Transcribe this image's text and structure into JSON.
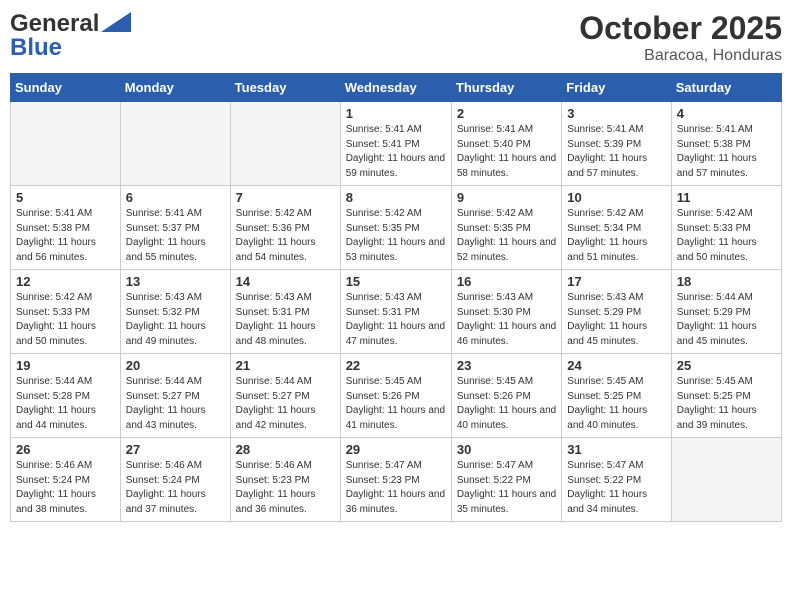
{
  "header": {
    "logo_general": "General",
    "logo_blue": "Blue",
    "month": "October 2025",
    "location": "Baracoa, Honduras"
  },
  "days_of_week": [
    "Sunday",
    "Monday",
    "Tuesday",
    "Wednesday",
    "Thursday",
    "Friday",
    "Saturday"
  ],
  "weeks": [
    [
      {
        "day": "",
        "sunrise": "",
        "sunset": "",
        "daylight": "",
        "empty": true
      },
      {
        "day": "",
        "sunrise": "",
        "sunset": "",
        "daylight": "",
        "empty": true
      },
      {
        "day": "",
        "sunrise": "",
        "sunset": "",
        "daylight": "",
        "empty": true
      },
      {
        "day": "1",
        "sunrise": "Sunrise: 5:41 AM",
        "sunset": "Sunset: 5:41 PM",
        "daylight": "Daylight: 11 hours and 59 minutes.",
        "empty": false
      },
      {
        "day": "2",
        "sunrise": "Sunrise: 5:41 AM",
        "sunset": "Sunset: 5:40 PM",
        "daylight": "Daylight: 11 hours and 58 minutes.",
        "empty": false
      },
      {
        "day": "3",
        "sunrise": "Sunrise: 5:41 AM",
        "sunset": "Sunset: 5:39 PM",
        "daylight": "Daylight: 11 hours and 57 minutes.",
        "empty": false
      },
      {
        "day": "4",
        "sunrise": "Sunrise: 5:41 AM",
        "sunset": "Sunset: 5:38 PM",
        "daylight": "Daylight: 11 hours and 57 minutes.",
        "empty": false
      }
    ],
    [
      {
        "day": "5",
        "sunrise": "Sunrise: 5:41 AM",
        "sunset": "Sunset: 5:38 PM",
        "daylight": "Daylight: 11 hours and 56 minutes.",
        "empty": false
      },
      {
        "day": "6",
        "sunrise": "Sunrise: 5:41 AM",
        "sunset": "Sunset: 5:37 PM",
        "daylight": "Daylight: 11 hours and 55 minutes.",
        "empty": false
      },
      {
        "day": "7",
        "sunrise": "Sunrise: 5:42 AM",
        "sunset": "Sunset: 5:36 PM",
        "daylight": "Daylight: 11 hours and 54 minutes.",
        "empty": false
      },
      {
        "day": "8",
        "sunrise": "Sunrise: 5:42 AM",
        "sunset": "Sunset: 5:35 PM",
        "daylight": "Daylight: 11 hours and 53 minutes.",
        "empty": false
      },
      {
        "day": "9",
        "sunrise": "Sunrise: 5:42 AM",
        "sunset": "Sunset: 5:35 PM",
        "daylight": "Daylight: 11 hours and 52 minutes.",
        "empty": false
      },
      {
        "day": "10",
        "sunrise": "Sunrise: 5:42 AM",
        "sunset": "Sunset: 5:34 PM",
        "daylight": "Daylight: 11 hours and 51 minutes.",
        "empty": false
      },
      {
        "day": "11",
        "sunrise": "Sunrise: 5:42 AM",
        "sunset": "Sunset: 5:33 PM",
        "daylight": "Daylight: 11 hours and 50 minutes.",
        "empty": false
      }
    ],
    [
      {
        "day": "12",
        "sunrise": "Sunrise: 5:42 AM",
        "sunset": "Sunset: 5:33 PM",
        "daylight": "Daylight: 11 hours and 50 minutes.",
        "empty": false
      },
      {
        "day": "13",
        "sunrise": "Sunrise: 5:43 AM",
        "sunset": "Sunset: 5:32 PM",
        "daylight": "Daylight: 11 hours and 49 minutes.",
        "empty": false
      },
      {
        "day": "14",
        "sunrise": "Sunrise: 5:43 AM",
        "sunset": "Sunset: 5:31 PM",
        "daylight": "Daylight: 11 hours and 48 minutes.",
        "empty": false
      },
      {
        "day": "15",
        "sunrise": "Sunrise: 5:43 AM",
        "sunset": "Sunset: 5:31 PM",
        "daylight": "Daylight: 11 hours and 47 minutes.",
        "empty": false
      },
      {
        "day": "16",
        "sunrise": "Sunrise: 5:43 AM",
        "sunset": "Sunset: 5:30 PM",
        "daylight": "Daylight: 11 hours and 46 minutes.",
        "empty": false
      },
      {
        "day": "17",
        "sunrise": "Sunrise: 5:43 AM",
        "sunset": "Sunset: 5:29 PM",
        "daylight": "Daylight: 11 hours and 45 minutes.",
        "empty": false
      },
      {
        "day": "18",
        "sunrise": "Sunrise: 5:44 AM",
        "sunset": "Sunset: 5:29 PM",
        "daylight": "Daylight: 11 hours and 45 minutes.",
        "empty": false
      }
    ],
    [
      {
        "day": "19",
        "sunrise": "Sunrise: 5:44 AM",
        "sunset": "Sunset: 5:28 PM",
        "daylight": "Daylight: 11 hours and 44 minutes.",
        "empty": false
      },
      {
        "day": "20",
        "sunrise": "Sunrise: 5:44 AM",
        "sunset": "Sunset: 5:27 PM",
        "daylight": "Daylight: 11 hours and 43 minutes.",
        "empty": false
      },
      {
        "day": "21",
        "sunrise": "Sunrise: 5:44 AM",
        "sunset": "Sunset: 5:27 PM",
        "daylight": "Daylight: 11 hours and 42 minutes.",
        "empty": false
      },
      {
        "day": "22",
        "sunrise": "Sunrise: 5:45 AM",
        "sunset": "Sunset: 5:26 PM",
        "daylight": "Daylight: 11 hours and 41 minutes.",
        "empty": false
      },
      {
        "day": "23",
        "sunrise": "Sunrise: 5:45 AM",
        "sunset": "Sunset: 5:26 PM",
        "daylight": "Daylight: 11 hours and 40 minutes.",
        "empty": false
      },
      {
        "day": "24",
        "sunrise": "Sunrise: 5:45 AM",
        "sunset": "Sunset: 5:25 PM",
        "daylight": "Daylight: 11 hours and 40 minutes.",
        "empty": false
      },
      {
        "day": "25",
        "sunrise": "Sunrise: 5:45 AM",
        "sunset": "Sunset: 5:25 PM",
        "daylight": "Daylight: 11 hours and 39 minutes.",
        "empty": false
      }
    ],
    [
      {
        "day": "26",
        "sunrise": "Sunrise: 5:46 AM",
        "sunset": "Sunset: 5:24 PM",
        "daylight": "Daylight: 11 hours and 38 minutes.",
        "empty": false
      },
      {
        "day": "27",
        "sunrise": "Sunrise: 5:46 AM",
        "sunset": "Sunset: 5:24 PM",
        "daylight": "Daylight: 11 hours and 37 minutes.",
        "empty": false
      },
      {
        "day": "28",
        "sunrise": "Sunrise: 5:46 AM",
        "sunset": "Sunset: 5:23 PM",
        "daylight": "Daylight: 11 hours and 36 minutes.",
        "empty": false
      },
      {
        "day": "29",
        "sunrise": "Sunrise: 5:47 AM",
        "sunset": "Sunset: 5:23 PM",
        "daylight": "Daylight: 11 hours and 36 minutes.",
        "empty": false
      },
      {
        "day": "30",
        "sunrise": "Sunrise: 5:47 AM",
        "sunset": "Sunset: 5:22 PM",
        "daylight": "Daylight: 11 hours and 35 minutes.",
        "empty": false
      },
      {
        "day": "31",
        "sunrise": "Sunrise: 5:47 AM",
        "sunset": "Sunset: 5:22 PM",
        "daylight": "Daylight: 11 hours and 34 minutes.",
        "empty": false
      },
      {
        "day": "",
        "sunrise": "",
        "sunset": "",
        "daylight": "",
        "empty": true
      }
    ]
  ]
}
